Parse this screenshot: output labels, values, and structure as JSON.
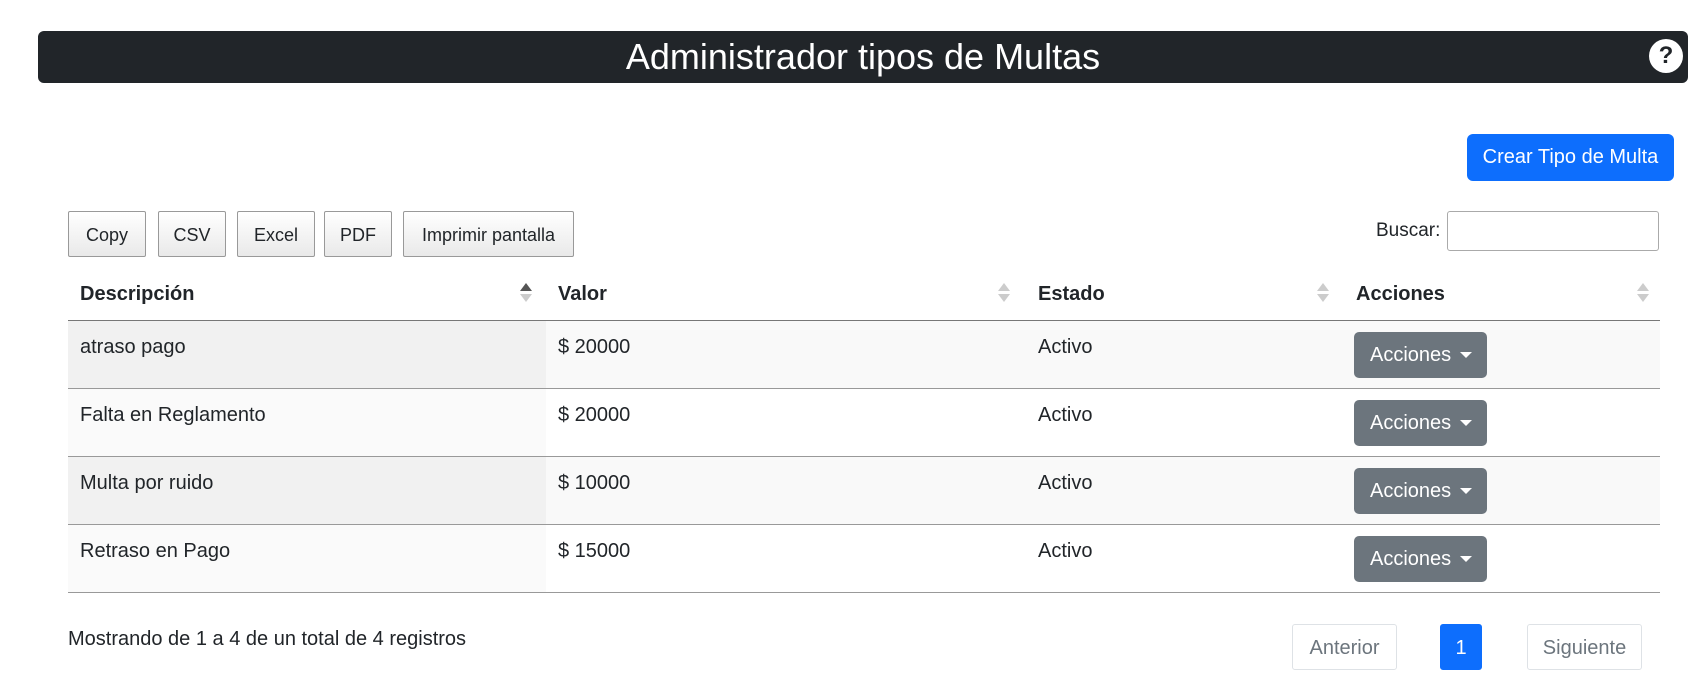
{
  "header": {
    "title": "Administrador tipos de Multas",
    "help_label": "?"
  },
  "create_button": "Crear Tipo de Multa",
  "export_buttons": [
    "Copy",
    "CSV",
    "Excel",
    "PDF",
    "Imprimir pantalla"
  ],
  "search": {
    "label": "Buscar:",
    "value": ""
  },
  "table": {
    "columns": [
      "Descripción",
      "Valor",
      "Estado",
      "Acciones"
    ],
    "sorted_column": "Descripción",
    "rows": [
      {
        "descripcion": "atraso pago",
        "valor": "$ 20000",
        "estado": "Activo",
        "acciones": "Acciones"
      },
      {
        "descripcion": "Falta en Reglamento",
        "valor": "$ 20000",
        "estado": "Activo",
        "acciones": "Acciones"
      },
      {
        "descripcion": "Multa por ruido",
        "valor": "$ 10000",
        "estado": "Activo",
        "acciones": "Acciones"
      },
      {
        "descripcion": "Retraso en Pago",
        "valor": "$ 15000",
        "estado": "Activo",
        "acciones": "Acciones"
      }
    ]
  },
  "info": "Mostrando de 1 a 4 de un total de 4 registros",
  "pagination": {
    "previous": "Anterior",
    "current_page": "1",
    "next": "Siguiente"
  },
  "colors": {
    "header_bg": "#212529",
    "primary": "#0d6efd",
    "secondary": "#6c757d"
  },
  "icons": {
    "help": "question-circle-icon",
    "sort": "sort-arrows-icon",
    "caret": "caret-down-icon"
  }
}
